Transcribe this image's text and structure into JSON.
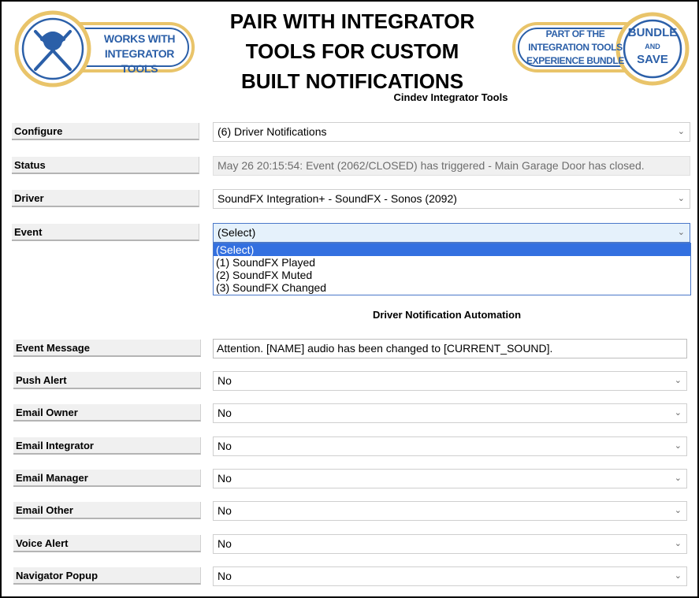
{
  "banner": {
    "headline_lines": [
      "PAIR WITH INTEGRATOR",
      "TOOLS FOR CUSTOM",
      "BUILT NOTIFICATIONS"
    ],
    "left_badge": {
      "line1": "WORKS WITH",
      "line2": "INTEGRATOR TOOLS",
      "icon": "tools-worker-icon"
    },
    "right_badge": {
      "line1": "PART OF THE",
      "line2": "INTEGRATION TOOLS",
      "line3": "EXPERIENCE BUNDLE",
      "seal_line1": "BUNDLE",
      "seal_line2": "AND",
      "seal_line3": "SAVE"
    }
  },
  "section1_title": "Cindev Integrator Tools",
  "section2_title": "Driver Notification Automation",
  "fields": {
    "configure": {
      "label": "Configure",
      "value": "(6) Driver Notifications"
    },
    "status": {
      "label": "Status",
      "value": "May 26 20:15:54: Event (2062/CLOSED) has triggered - Main Garage Door has closed."
    },
    "driver": {
      "label": "Driver",
      "value": "SoundFX Integration+ - SoundFX - Sonos (2092)"
    },
    "event": {
      "label": "Event",
      "value": "(Select)",
      "options": [
        "(Select)",
        "(1) SoundFX Played",
        "(2) SoundFX Muted",
        "(3) SoundFX Changed"
      ]
    },
    "event_message": {
      "label": "Event Message",
      "value": "Attention.  [NAME] audio has been changed to [CURRENT_SOUND]."
    },
    "push_alert": {
      "label": "Push Alert",
      "value": "No"
    },
    "email_owner": {
      "label": "Email Owner",
      "value": "No"
    },
    "email_integrator": {
      "label": "Email Integrator",
      "value": "No"
    },
    "email_manager": {
      "label": "Email Manager",
      "value": "No"
    },
    "email_other": {
      "label": "Email Other",
      "value": "No"
    },
    "voice_alert": {
      "label": "Voice Alert",
      "value": "No"
    },
    "navigator_popup": {
      "label": "Navigator Popup",
      "value": "No"
    }
  },
  "colors": {
    "badge_blue": "#2b5fa8",
    "badge_gold": "#e9c46a",
    "selection": "#3370e0"
  }
}
